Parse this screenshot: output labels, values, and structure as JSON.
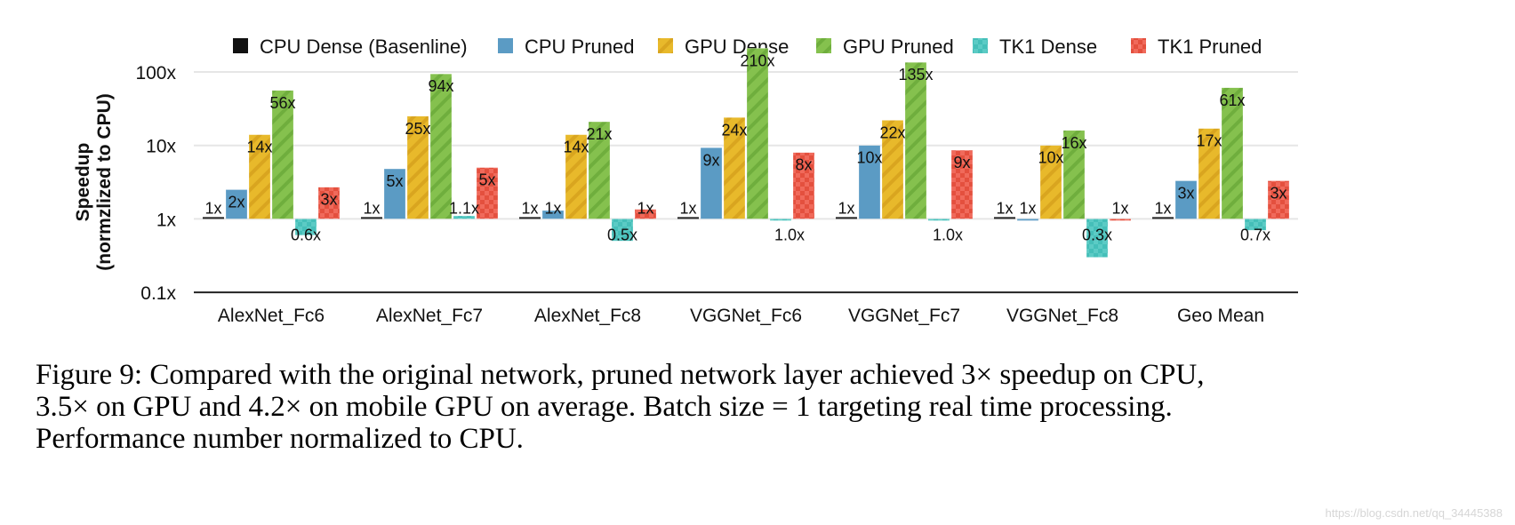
{
  "chart_data": {
    "type": "bar",
    "title": "",
    "xlabel": "",
    "ylabel": [
      "Speedup",
      "(normzlized to CPU)"
    ],
    "yscale": "log",
    "ylim": [
      0.1,
      100
    ],
    "yticks": [
      {
        "value": 100,
        "label": "100x"
      },
      {
        "value": 10,
        "label": "10x"
      },
      {
        "value": 1,
        "label": "1x"
      },
      {
        "value": 0.1,
        "label": "0.1x"
      }
    ],
    "grid": true,
    "legend_position": "top",
    "categories": [
      "AlexNet_Fc6",
      "AlexNet_Fc7",
      "AlexNet_Fc8",
      "VGGNet_Fc6",
      "VGGNet_Fc7",
      "VGGNet_Fc8",
      "Geo Mean"
    ],
    "series": [
      {
        "name": "CPU Dense (Basenline)",
        "color": "#111111",
        "pattern": "solid",
        "values": [
          1,
          1,
          1,
          1,
          1,
          1,
          1
        ],
        "labels": [
          "1x",
          "1x",
          "1x",
          "1x",
          "1x",
          "1x",
          "1x"
        ]
      },
      {
        "name": "CPU Pruned",
        "color": "#5b9bc4",
        "pattern": "solid",
        "values": [
          2.5,
          4.8,
          1.3,
          9.3,
          10,
          1,
          3.3
        ],
        "labels": [
          "2x",
          "5x",
          "1x",
          "9x",
          "10x",
          "1x",
          "3x"
        ]
      },
      {
        "name": "GPU Dense",
        "color": "#e8b92b",
        "pattern": "stripes",
        "values": [
          14,
          25,
          14,
          24,
          22,
          10,
          17
        ],
        "labels": [
          "14x",
          "25x",
          "14x",
          "24x",
          "22x",
          "10x",
          "17x"
        ]
      },
      {
        "name": "GPU Pruned",
        "color": "#85c14e",
        "pattern": "stripes",
        "values": [
          56,
          94,
          21,
          210,
          135,
          16,
          61
        ],
        "labels": [
          "56x",
          "94x",
          "21x",
          "210x",
          "135x",
          "16x",
          "61x"
        ]
      },
      {
        "name": "TK1 Dense",
        "color": "#45bfb9",
        "pattern": "checks",
        "values": [
          0.6,
          1.1,
          0.5,
          1.0,
          1.0,
          0.3,
          0.7
        ],
        "labels": [
          "0.6x",
          "1.1x",
          "0.5x",
          "1.0x",
          "1.0x",
          "0.3x",
          "0.7x"
        ]
      },
      {
        "name": "TK1 Pruned",
        "color": "#e4503e",
        "pattern": "checks",
        "values": [
          2.7,
          5,
          1.35,
          8,
          8.6,
          1,
          3.3
        ],
        "labels": [
          "3x",
          "5x",
          "1x",
          "8x",
          "9x",
          "1x",
          "3x"
        ]
      }
    ]
  },
  "caption": {
    "lines": [
      "Figure 9: Compared with the original network, pruned network layer achieved 3× speedup on CPU,",
      "3.5× on GPU and 4.2× on mobile GPU on average. Batch size = 1 targeting real time processing.",
      "Performance number normalized to CPU."
    ]
  },
  "watermark": "https://blog.csdn.net/qq_34445388"
}
